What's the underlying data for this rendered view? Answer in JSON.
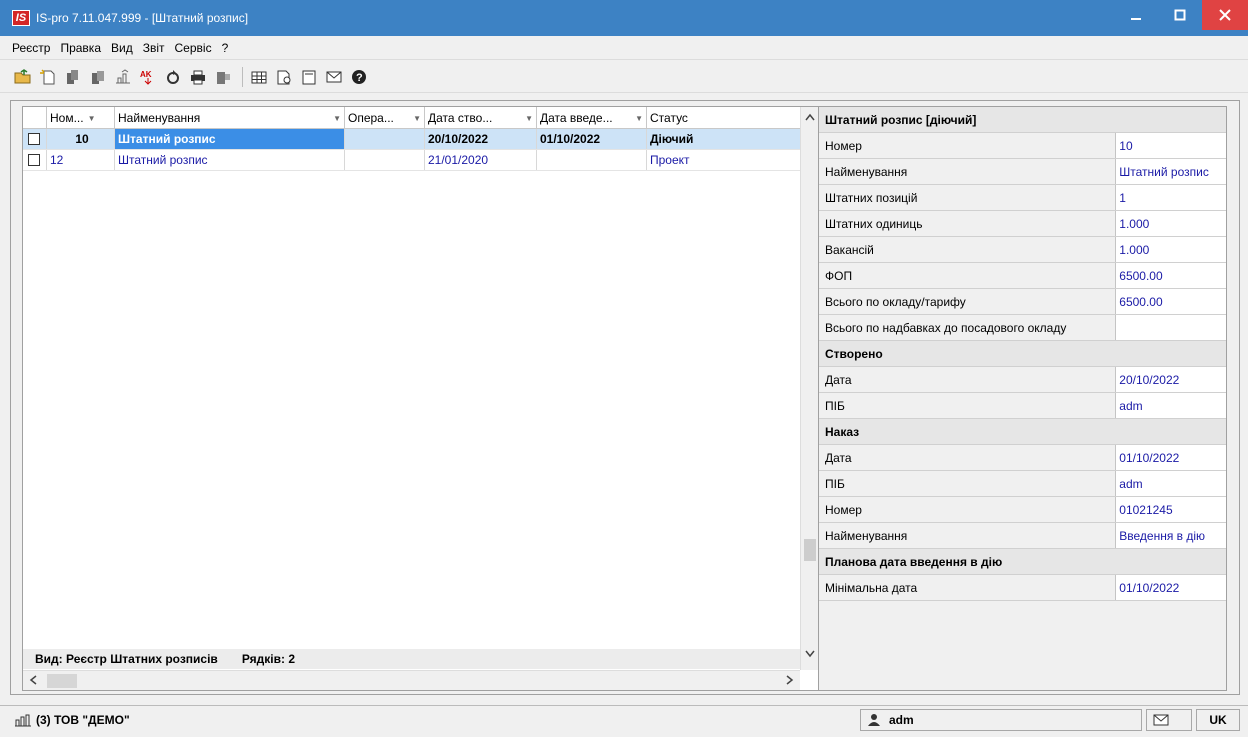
{
  "window": {
    "title": "IS-pro 7.11.047.999 - [Штатний розпис]",
    "app_badge": "IS",
    "accent_color": "#3d82c4",
    "close_color": "#e04343"
  },
  "menu": [
    "Реєстр",
    "Правка",
    "Вид",
    "Звіт",
    "Сервіс",
    "?"
  ],
  "toolbar_icons": [
    "open-folder-icon",
    "new-document-icon",
    "copy-icon",
    "delete-icon",
    "structure-icon",
    "sort-icon",
    "refresh-icon",
    "print-icon",
    "export-icon",
    "table-icon",
    "report-icon",
    "form-icon",
    "mail-icon",
    "help-icon"
  ],
  "grid": {
    "columns": [
      "Ном...",
      "Найменування",
      "Опера...",
      "Дата ство...",
      "Дата введе...",
      "Статус"
    ],
    "rows": [
      {
        "number": "10",
        "name": "Штатний розпис",
        "operation": "",
        "created": "20/10/2022",
        "effective": "01/10/2022",
        "status": "Діючий",
        "selected": true
      },
      {
        "number": "12",
        "name": "Штатний розпис",
        "operation": "",
        "created": "21/01/2020",
        "effective": "",
        "status": "Проект",
        "selected": false
      }
    ],
    "footer_view": "Вид: Реєстр Штатних розписів",
    "footer_rows": "Рядків: 2"
  },
  "properties": {
    "header": "Штатний розпис [діючий]",
    "main": [
      {
        "label": "Номер",
        "value": "10"
      },
      {
        "label": "Найменування",
        "value": "Штатний розпис"
      },
      {
        "label": "Штатних позицій",
        "value": "1"
      },
      {
        "label": "Штатних одиниць",
        "value": "1.000"
      },
      {
        "label": "Вакансій",
        "value": "1.000"
      },
      {
        "label": "ФОП",
        "value": "6500.00"
      },
      {
        "label": "Всього по окладу/тарифу",
        "value": "6500.00"
      },
      {
        "label": "Всього по надбавках до посадового окладу",
        "value": ""
      }
    ],
    "created_section": "Створено",
    "created": [
      {
        "label": "Дата",
        "value": "20/10/2022"
      },
      {
        "label": "ПІБ",
        "value": "adm"
      }
    ],
    "order_section": "Наказ",
    "order": [
      {
        "label": "Дата",
        "value": "01/10/2022"
      },
      {
        "label": "ПІБ",
        "value": "adm"
      },
      {
        "label": "Номер",
        "value": "01021245"
      },
      {
        "label": "Найменування",
        "value": "Введення в дію"
      }
    ],
    "planned_section": "Планова дата введення в дію",
    "planned": [
      {
        "label": "Мінімальна дата",
        "value": "01/10/2022"
      }
    ]
  },
  "statusbar": {
    "company": "(3) ТОВ \"ДЕМО\"",
    "user": "adm",
    "lang": "UK"
  }
}
